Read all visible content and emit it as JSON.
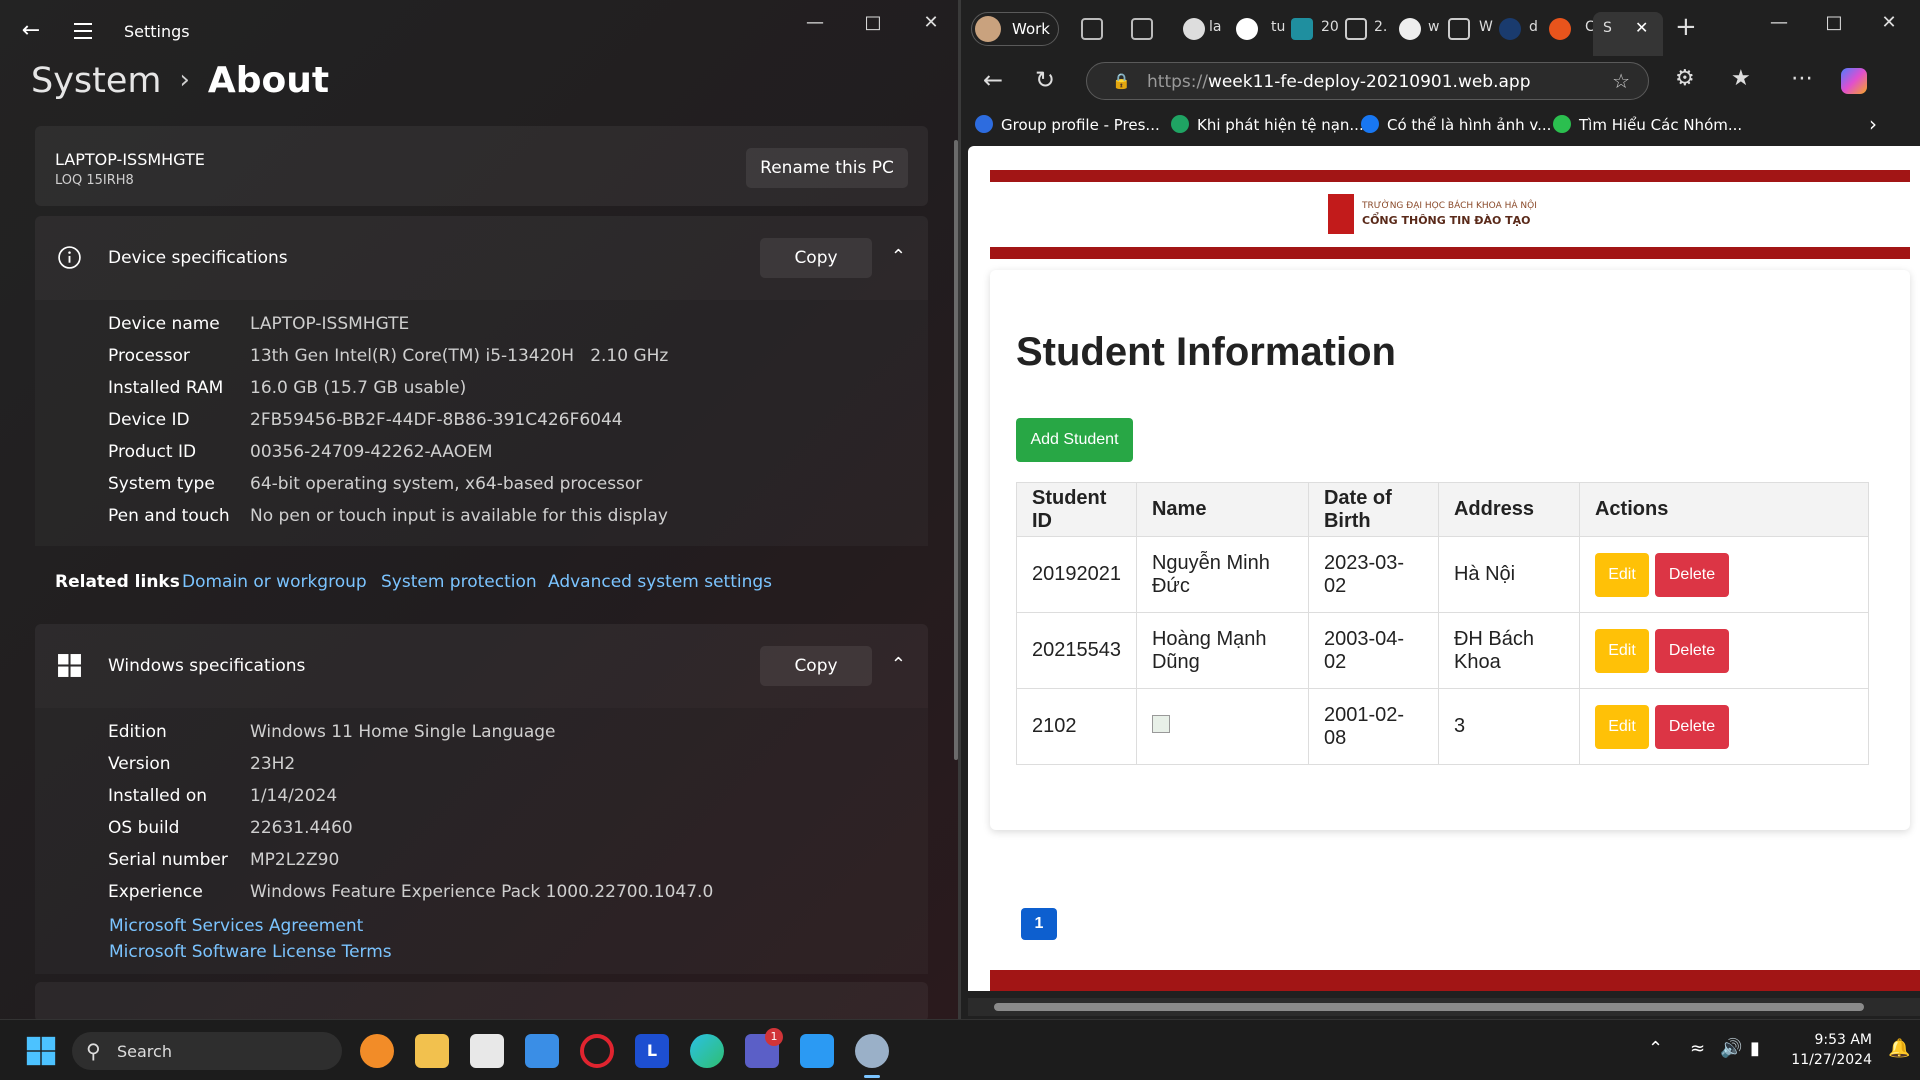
{
  "settings": {
    "app_title": "Settings",
    "breadcrumb": {
      "parent": "System",
      "current": "About"
    },
    "pc": {
      "name": "LAPTOP-ISSMHGTE",
      "model": "LOQ 15IRH8",
      "rename_label": "Rename this PC"
    },
    "device_specs": {
      "title": "Device specifications",
      "copy_label": "Copy",
      "rows": [
        {
          "key": "Device name",
          "value": "LAPTOP-ISSMHGTE"
        },
        {
          "key": "Processor",
          "value": "13th Gen Intel(R) Core(TM) i5-13420H   2.10 GHz"
        },
        {
          "key": "Installed RAM",
          "value": "16.0 GB (15.7 GB usable)"
        },
        {
          "key": "Device ID",
          "value": "2FB59456-BB2F-44DF-8B86-391C426F6044"
        },
        {
          "key": "Product ID",
          "value": "00356-24709-42262-AAOEM"
        },
        {
          "key": "System type",
          "value": "64-bit operating system, x64-based processor"
        },
        {
          "key": "Pen and touch",
          "value": "No pen or touch input is available for this display"
        }
      ]
    },
    "related": {
      "label": "Related links",
      "links": [
        "Domain or workgroup",
        "System protection",
        "Advanced system settings"
      ]
    },
    "windows_specs": {
      "title": "Windows specifications",
      "copy_label": "Copy",
      "rows": [
        {
          "key": "Edition",
          "value": "Windows 11 Home Single Language"
        },
        {
          "key": "Version",
          "value": "23H2"
        },
        {
          "key": "Installed on",
          "value": "1/14/2024"
        },
        {
          "key": "OS build",
          "value": "22631.4460"
        },
        {
          "key": "Serial number",
          "value": "MP2L2Z90"
        },
        {
          "key": "Experience",
          "value": "Windows Feature Experience Pack 1000.22700.1047.0"
        }
      ],
      "links": [
        "Microsoft Services Agreement",
        "Microsoft Software License Terms"
      ]
    }
  },
  "browser": {
    "profile_label": "Work",
    "tab_snippets": [
      "la",
      "tu",
      "20",
      "2.",
      "w",
      "W",
      "d",
      "C",
      "S"
    ],
    "url_prefix": "https://",
    "url_host": "week11-fe-deploy-20210901.web.app",
    "favorites": [
      {
        "label": "Group profile - Pres...",
        "color": "#2d6cdf"
      },
      {
        "label": "Khi phát hiện tệ nạn...",
        "color": "#1fa463"
      },
      {
        "label": "Có thể là hình ảnh v...",
        "color": "#1877f2"
      },
      {
        "label": "Tìm Hiểu Các Nhóm...",
        "color": "#2bbf4f"
      }
    ],
    "page": {
      "logo_line1": "TRƯỜNG ĐẠI HỌC BÁCH KHOA HÀ NỘI",
      "logo_line2": "CỔNG THÔNG TIN ĐÀO TẠO",
      "heading": "Student Information",
      "add_label": "Add Student",
      "columns": [
        "Student ID",
        "Name",
        "Date of Birth",
        "Address",
        "Actions"
      ],
      "rows": [
        {
          "id": "20192021",
          "name": "Nguyễn Minh Đức",
          "dob": "2023-03-02",
          "address": "Hà Nội"
        },
        {
          "id": "20215543",
          "name": "Hoàng Mạnh Dũng",
          "dob": "2003-04-02",
          "address": "ĐH Bách Khoa"
        },
        {
          "id": "2102",
          "name": "",
          "dob": "2001-02-08",
          "address": "3"
        }
      ],
      "edit_label": "Edit",
      "delete_label": "Delete",
      "current_page": "1"
    }
  },
  "taskbar": {
    "search_label": "Search",
    "teams_badge": "1",
    "time": "9:53 AM",
    "date": "11/27/2024"
  }
}
